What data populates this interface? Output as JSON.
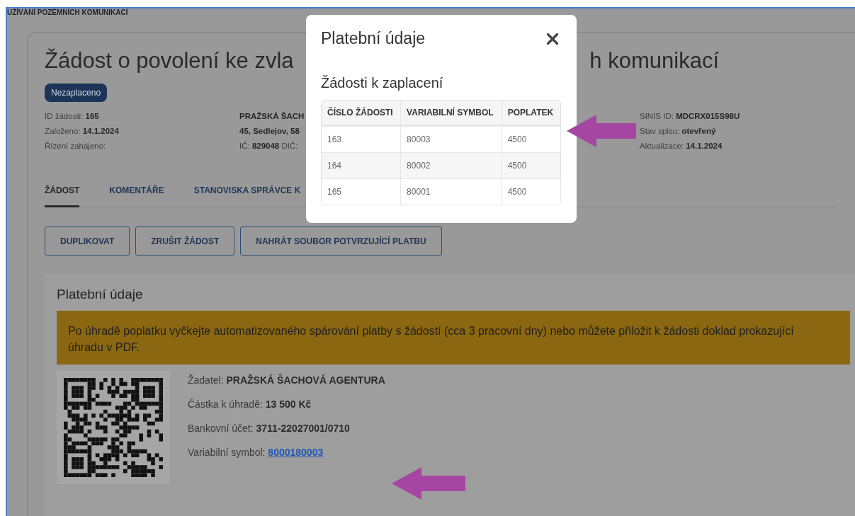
{
  "header_fragment": "UŽÍVÁNÍ POZEMNÍCH KOMUNIKACÍ",
  "title_parts": [
    "Žádost o povolení ke zvla",
    "h komunikací"
  ],
  "status_badge": "Nezaplaceno",
  "info_columns": [
    [
      {
        "text": "ID žádosti: **165**"
      },
      {
        "text": "Založeno: **14.1.2024**"
      },
      {
        "text": "Řízení zahájeno:"
      }
    ],
    [
      {
        "text": "**PRAŽSKÁ ŠACH**"
      },
      {
        "text": "**45, Sedlejov, 58**"
      },
      {
        "text": "IČ: **829048** DIČ:"
      }
    ],
    [
      {
        "text": "SINIS ID: **MDCRX015S98U**"
      },
      {
        "text": "Stav spisu: **otevřený**"
      },
      {
        "text": "Aktualizace: **14.1.2024**"
      }
    ]
  ],
  "tabs": [
    {
      "label": "ŽÁDOST",
      "selected": true
    },
    {
      "label": "KOMENTÁŘE",
      "selected": false
    },
    {
      "label": "STANOVISKA SPRÁVCE K",
      "selected": false
    }
  ],
  "buttons": [
    "DUPLIKOVAT",
    "ZRUŠIT ŽÁDOST",
    "NAHRÁT SOUBOR POTVRZUJÍCÍ PLATBU"
  ],
  "payment_panel": {
    "title": "Platební údaje",
    "alert": "Po úhradě poplatku vyčkejte automatizovaného spárování platby s žádostí (cca 3 pracovní dny) nebo můžete přiložit k žádosti doklad prokazující úhradu v PDF.",
    "details": [
      {
        "kind": "text",
        "label": "Žadatel:",
        "value": "PRAŽSKÁ ŠACHOVÁ AGENTURA"
      },
      {
        "kind": "text",
        "label": "Částka k úhradě:",
        "value": "13 500 Kč"
      },
      {
        "kind": "text",
        "label": "Bankovní účet:",
        "value": "3711-22027001/0710"
      },
      {
        "kind": "link",
        "label": "Variabilní symbol:",
        "value": "8000180003"
      }
    ]
  },
  "modal": {
    "title": "Platební údaje",
    "subtitle": "Žádosti k zaplacení",
    "table": {
      "columns": [
        "ČÍSLO ŽÁDOSTI",
        "VARIABILNÍ SYMBOL",
        "POPLATEK"
      ],
      "rows": [
        [
          "163",
          "80003",
          "4500"
        ],
        [
          "164",
          "80002",
          "4500"
        ],
        [
          "165",
          "80001",
          "4500"
        ]
      ]
    }
  }
}
